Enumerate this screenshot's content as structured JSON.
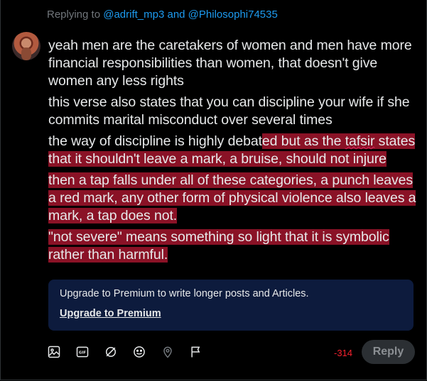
{
  "reply_context": {
    "prefix": "Replying to ",
    "handles": "@adrift_mp3 and @Philosophi74535"
  },
  "post": {
    "paragraphs": {
      "p1": "yeah men are the caretakers of women and men have more financial responsibilities than women, that doesn't give women any less rights",
      "p2": "this verse also states that you can discipline your wife if she commits marital misconduct over several times",
      "p3_plain": "the way of discipline is highly debat",
      "p3_hl_1": "ed but as the ",
      "p3_hl_word": "tafsir",
      "p3_hl_2": " states that it shouldn't leave a mark, a bruise, should not injure",
      "p4": "then a tap falls under all of these categories, a punch leaves a red mark, any other form of physical violence also leaves a mark, a tap does not.",
      "p5": "\"not severe\" means something so light that it is symbolic rather than harmful."
    }
  },
  "premium_banner": {
    "message": "Upgrade to Premium to write longer posts and Articles.",
    "link_label": "Upgrade to Premium"
  },
  "toolbar": {
    "icons": [
      "image-icon",
      "gif-icon",
      "grok-icon",
      "emoji-icon",
      "location-icon",
      "flag-icon"
    ]
  },
  "char_counter": "-314",
  "reply_button_label": "Reply",
  "colors": {
    "highlight": "#8a1226",
    "link": "#1d9bf0",
    "premium_bg": "#0d1b3d",
    "counter": "#f4212e"
  }
}
